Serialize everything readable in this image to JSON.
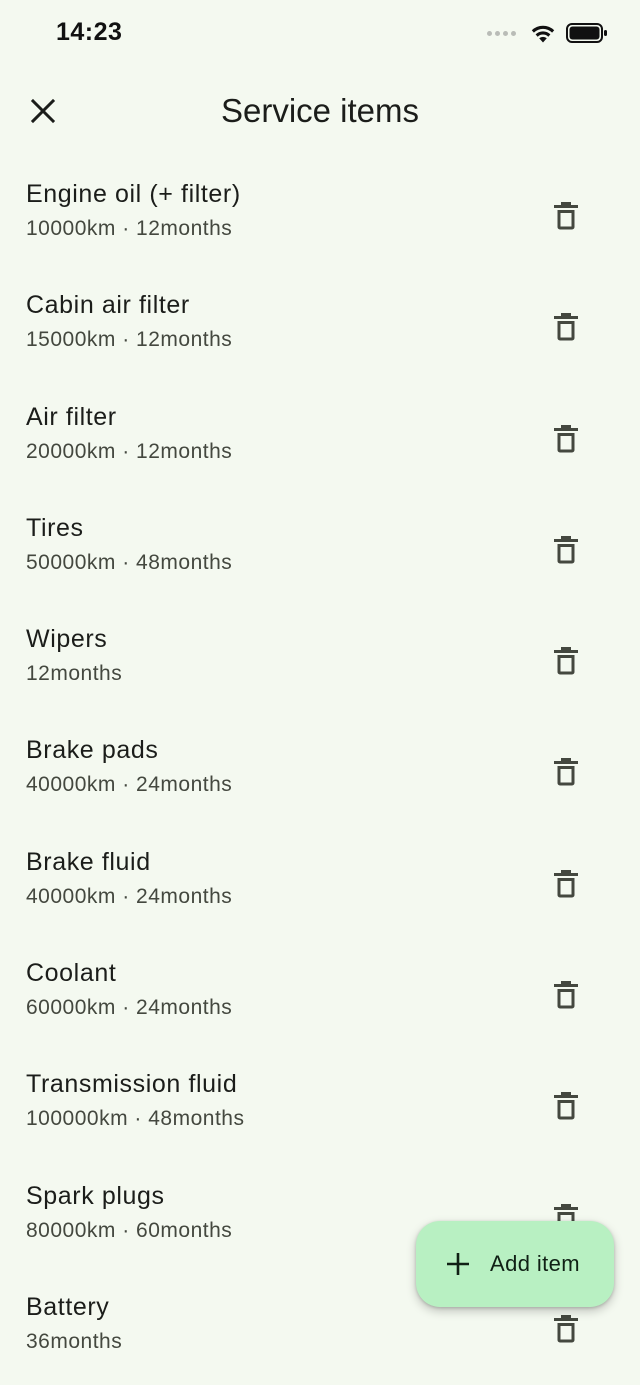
{
  "status_bar": {
    "time": "14:23"
  },
  "app_bar": {
    "title": "Service items"
  },
  "items": [
    {
      "title": "Engine oil (+ filter)",
      "subtitle": "10000km · 12months"
    },
    {
      "title": "Cabin air filter",
      "subtitle": "15000km · 12months"
    },
    {
      "title": "Air filter",
      "subtitle": "20000km · 12months"
    },
    {
      "title": "Tires",
      "subtitle": "50000km · 48months"
    },
    {
      "title": "Wipers",
      "subtitle": "12months"
    },
    {
      "title": "Brake pads",
      "subtitle": "40000km · 24months"
    },
    {
      "title": "Brake fluid",
      "subtitle": "40000km · 24months"
    },
    {
      "title": "Coolant",
      "subtitle": "60000km · 24months"
    },
    {
      "title": "Transmission fluid",
      "subtitle": "100000km · 48months"
    },
    {
      "title": "Spark plugs",
      "subtitle": "80000km · 60months"
    },
    {
      "title": "Battery",
      "subtitle": "36months"
    }
  ],
  "fab": {
    "label": "Add item"
  },
  "icons": {
    "close": "close-icon",
    "delete": "trash-icon",
    "add": "plus-icon",
    "wifi": "wifi-icon",
    "battery": "battery-icon",
    "signal": "signal-icon"
  },
  "colors": {
    "background": "#f4f9f0",
    "fab": "#b8f0c2",
    "text": "#1b1d1a",
    "secondary_text": "#44483f"
  }
}
